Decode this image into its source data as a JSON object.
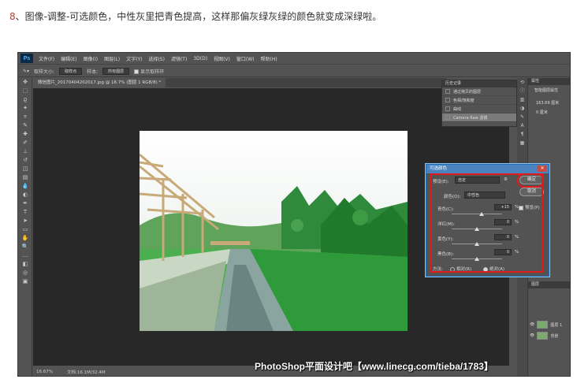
{
  "caption": {
    "number": "8",
    "text": "、图像-调整-可选颜色，中性灰里把青色提高，这样那偏灰绿灰绿的颜色就变成深绿啦。"
  },
  "app": {
    "logo": "Ps",
    "menu": [
      "文件(F)",
      "编辑(E)",
      "图像(I)",
      "图层(L)",
      "文字(Y)",
      "选择(S)",
      "滤镜(T)",
      "3D(D)",
      "视图(V)",
      "窗口(W)",
      "帮助(H)"
    ]
  },
  "options_bar": {
    "size_label": "取样大小:",
    "size_value": "取样点",
    "sample_label": "样本:",
    "sample_value": "所有图层",
    "show_ring": "显示取样环"
  },
  "document": {
    "tab": "微信图片_20170404202017.jpg @ 16.7% (图层 1 RGB/8) *",
    "zoom": "16.67%",
    "doc_info": "文档:16.1M/32.4M"
  },
  "history": {
    "title": "历史记录",
    "items": [
      "通过拷贝的图层",
      "色相/饱和度",
      "曲线",
      "Camera Raw 滤镜"
    ],
    "active_index": 3
  },
  "properties": {
    "tab": "属性",
    "sub": "智能图层属性",
    "w": "163.69 厘米",
    "h": "0 厘米"
  },
  "layers": {
    "tab": "图层",
    "rows": [
      "图层 1",
      "背景"
    ]
  },
  "dialog": {
    "title": "可选颜色",
    "preset_label": "预设(E):",
    "preset_value": "自定",
    "colors_label": "颜色(O):",
    "colors_value": "中性色",
    "ok": "确定",
    "cancel": "取消",
    "preview": "预览(P)",
    "sliders": [
      {
        "label": "青色(C):",
        "value": "+15",
        "unit": "%",
        "level": 0.6
      },
      {
        "label": "洋红(M):",
        "value": "0",
        "unit": "%",
        "level": 0.5
      },
      {
        "label": "黄色(Y):",
        "value": "0",
        "unit": "%",
        "level": 0.5
      },
      {
        "label": "黑色(B):",
        "value": "0",
        "unit": "%",
        "level": 0.5
      }
    ],
    "method_label": "方法:",
    "relative": "相对(R)",
    "absolute": "绝对(A)",
    "method_selected": "absolute"
  },
  "watermark": "PhotoShop平面设计吧【www.linecg.com/tieba/1783】",
  "colors": {
    "accent_red": "#e11b1b",
    "title_blue": "#4a83c0",
    "ps_blue": "#4db4ff"
  }
}
